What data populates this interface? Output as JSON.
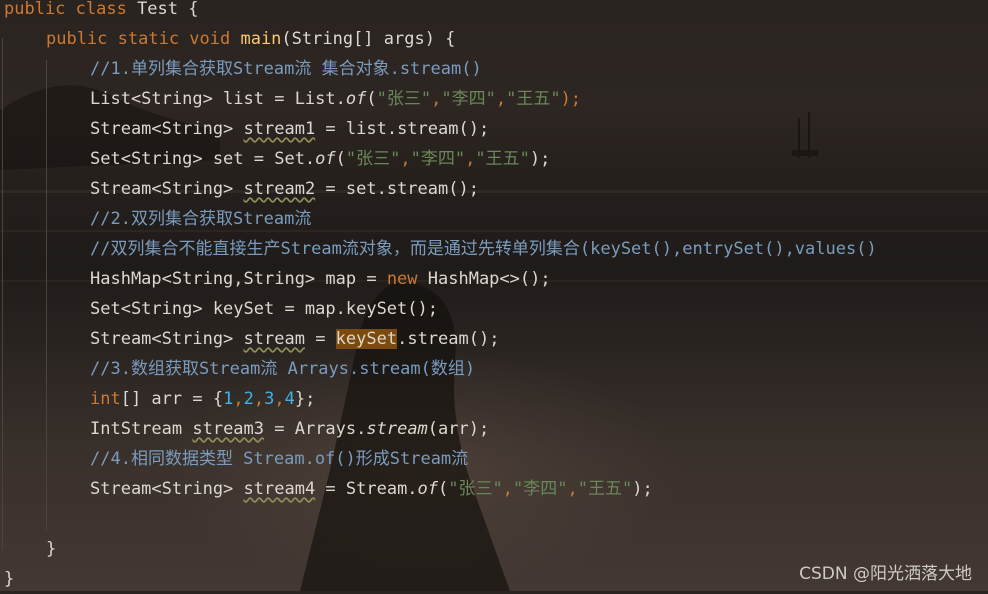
{
  "editor": {
    "lines": [
      {
        "id": "l1",
        "indent": 0,
        "tokens": [
          {
            "t": "public class ",
            "c": "kw"
          },
          {
            "t": "Test {",
            "c": "pl"
          }
        ]
      },
      {
        "id": "l2",
        "indent": 1,
        "tokens": [
          {
            "t": "public static void ",
            "c": "kw"
          },
          {
            "t": "main",
            "c": "fn"
          },
          {
            "t": "(String[] args) {",
            "c": "pl"
          }
        ]
      },
      {
        "id": "l3",
        "indent": 2,
        "tokens": [
          {
            "t": "//1.单列集合获取Stream流 集合对象.stream()",
            "c": "cm"
          }
        ]
      },
      {
        "id": "l4",
        "indent": 2,
        "tokens": [
          {
            "t": "List<String> list = List.",
            "c": "pl"
          },
          {
            "t": "of",
            "c": "it"
          },
          {
            "t": "(",
            "c": "pl"
          },
          {
            "t": "\"张三\"",
            "c": "str"
          },
          {
            "t": ",",
            "c": "kw"
          },
          {
            "t": "\"李四\"",
            "c": "str"
          },
          {
            "t": ",",
            "c": "kw"
          },
          {
            "t": "\"王五\"",
            "c": "str"
          },
          {
            "t": ");",
            "c": "kw"
          }
        ]
      },
      {
        "id": "l5",
        "indent": 2,
        "tokens": [
          {
            "t": "Stream<String> ",
            "c": "pl"
          },
          {
            "t": "stream1",
            "c": "wavy"
          },
          {
            "t": " = list.stream();",
            "c": "pl"
          }
        ]
      },
      {
        "id": "l6",
        "indent": 2,
        "tokens": [
          {
            "t": "Set<String> set = Set.",
            "c": "pl"
          },
          {
            "t": "of",
            "c": "it"
          },
          {
            "t": "(",
            "c": "pl"
          },
          {
            "t": "\"张三\"",
            "c": "str"
          },
          {
            "t": ",",
            "c": "kw"
          },
          {
            "t": "\"李四\"",
            "c": "str"
          },
          {
            "t": ",",
            "c": "kw"
          },
          {
            "t": "\"王五\"",
            "c": "str"
          },
          {
            "t": ");",
            "c": "pl"
          }
        ]
      },
      {
        "id": "l7",
        "indent": 2,
        "tokens": [
          {
            "t": "Stream<String> ",
            "c": "pl"
          },
          {
            "t": "stream2",
            "c": "wavy"
          },
          {
            "t": " = set.stream();",
            "c": "pl"
          }
        ]
      },
      {
        "id": "l8",
        "indent": 2,
        "tokens": [
          {
            "t": "//2.双列集合获取Stream流",
            "c": "cm"
          }
        ]
      },
      {
        "id": "l9",
        "indent": 2,
        "tokens": [
          {
            "t": "//双列集合不能直接生产Stream流对象，而是通过先转单列集合(keySet(),entrySet(),values()",
            "c": "cm"
          }
        ]
      },
      {
        "id": "l10",
        "indent": 2,
        "tokens": [
          {
            "t": "HashMap<String,String> map = ",
            "c": "pl"
          },
          {
            "t": "new ",
            "c": "kw"
          },
          {
            "t": "HashMap<>();",
            "c": "pl"
          }
        ]
      },
      {
        "id": "l11",
        "indent": 2,
        "tokens": [
          {
            "t": "Set<String> keySet = map.keySet();",
            "c": "pl"
          }
        ]
      },
      {
        "id": "l12",
        "indent": 2,
        "tokens": [
          {
            "t": "Stream<String> ",
            "c": "pl"
          },
          {
            "t": "stream",
            "c": "wavy"
          },
          {
            "t": " = ",
            "c": "pl"
          },
          {
            "t": "keySet",
            "c": "hl"
          },
          {
            "t": ".stream();",
            "c": "pl"
          }
        ]
      },
      {
        "id": "l13",
        "indent": 2,
        "tokens": [
          {
            "t": "//3.数组获取Stream流 Arrays.stream(数组)",
            "c": "cm"
          }
        ]
      },
      {
        "id": "l14",
        "indent": 2,
        "tokens": [
          {
            "t": "int",
            "c": "kw"
          },
          {
            "t": "[] arr = {",
            "c": "pl"
          },
          {
            "t": "1",
            "c": "num"
          },
          {
            "t": ",",
            "c": "kw"
          },
          {
            "t": "2",
            "c": "num"
          },
          {
            "t": ",",
            "c": "kw"
          },
          {
            "t": "3",
            "c": "num"
          },
          {
            "t": ",",
            "c": "kw"
          },
          {
            "t": "4",
            "c": "num"
          },
          {
            "t": "};",
            "c": "pl"
          }
        ]
      },
      {
        "id": "l15",
        "indent": 2,
        "tokens": [
          {
            "t": "IntStream ",
            "c": "pl"
          },
          {
            "t": "stream3",
            "c": "wavy"
          },
          {
            "t": " = Arrays.",
            "c": "pl"
          },
          {
            "t": "stream",
            "c": "it"
          },
          {
            "t": "(arr);",
            "c": "pl"
          }
        ]
      },
      {
        "id": "l16",
        "indent": 2,
        "tokens": [
          {
            "t": "//4.相同数据类型 Stream.of()形成Stream流",
            "c": "cm"
          }
        ]
      },
      {
        "id": "l17",
        "indent": 2,
        "tokens": [
          {
            "t": "Stream<String> ",
            "c": "pl"
          },
          {
            "t": "stream4",
            "c": "wavy"
          },
          {
            "t": " = Stream.",
            "c": "pl"
          },
          {
            "t": "of",
            "c": "it"
          },
          {
            "t": "(",
            "c": "pl"
          },
          {
            "t": "\"张三\"",
            "c": "str"
          },
          {
            "t": ",",
            "c": "kw"
          },
          {
            "t": "\"李四\"",
            "c": "str"
          },
          {
            "t": ",",
            "c": "kw"
          },
          {
            "t": "\"王五\"",
            "c": "str"
          },
          {
            "t": ");",
            "c": "pl"
          }
        ]
      },
      {
        "id": "l18",
        "indent": 0,
        "tokens": []
      },
      {
        "id": "l19",
        "indent": 1,
        "tokens": [
          {
            "t": "}",
            "c": "pl"
          }
        ]
      },
      {
        "id": "l20",
        "indent": 0,
        "tokens": [
          {
            "t": "}",
            "c": "pl"
          }
        ]
      }
    ]
  },
  "watermark": "CSDN @阳光洒落大地",
  "colors": {
    "keyword": "#cc7832",
    "function": "#ffc66d",
    "string": "#6a8759",
    "comment": "#7a9bbd",
    "number": "#3fb2e8",
    "plain": "#dcd7d0",
    "highlight": "#7a4a0e"
  }
}
